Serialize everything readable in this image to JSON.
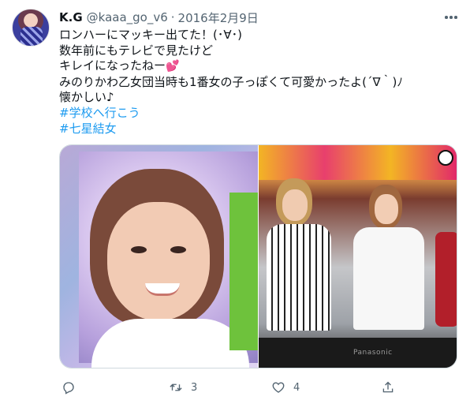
{
  "tweet": {
    "display_name": "K.G",
    "handle": "@kaaa_go_v6",
    "separator": "·",
    "date": "2016年2月9日",
    "lines": [
      "ロンハーにマッキー出てた！(･∀･)",
      "数年前にもテレビで見たけど",
      "キレイになったねー",
      "みのりかわ乙女団当時も1番女の子っぽくて可愛かったよ(´∇｀)ﾉ",
      "懐かしい♪"
    ],
    "heart_emoji": "💕",
    "hashtags": [
      "#学校へ行こう",
      "#七星結女"
    ]
  },
  "media": {
    "tv_brand": "Panasonic"
  },
  "actions": {
    "reply_count": "",
    "retweet_count": "3",
    "like_count": "4"
  },
  "colors": {
    "link": "#1d9bf0",
    "secondary_text": "#536471",
    "primary_text": "#0f1419"
  },
  "icons": {
    "avatar": "user-avatar",
    "more": "more-options-icon",
    "reply": "reply-icon",
    "retweet": "retweet-icon",
    "like": "heart-icon",
    "share": "share-icon"
  }
}
